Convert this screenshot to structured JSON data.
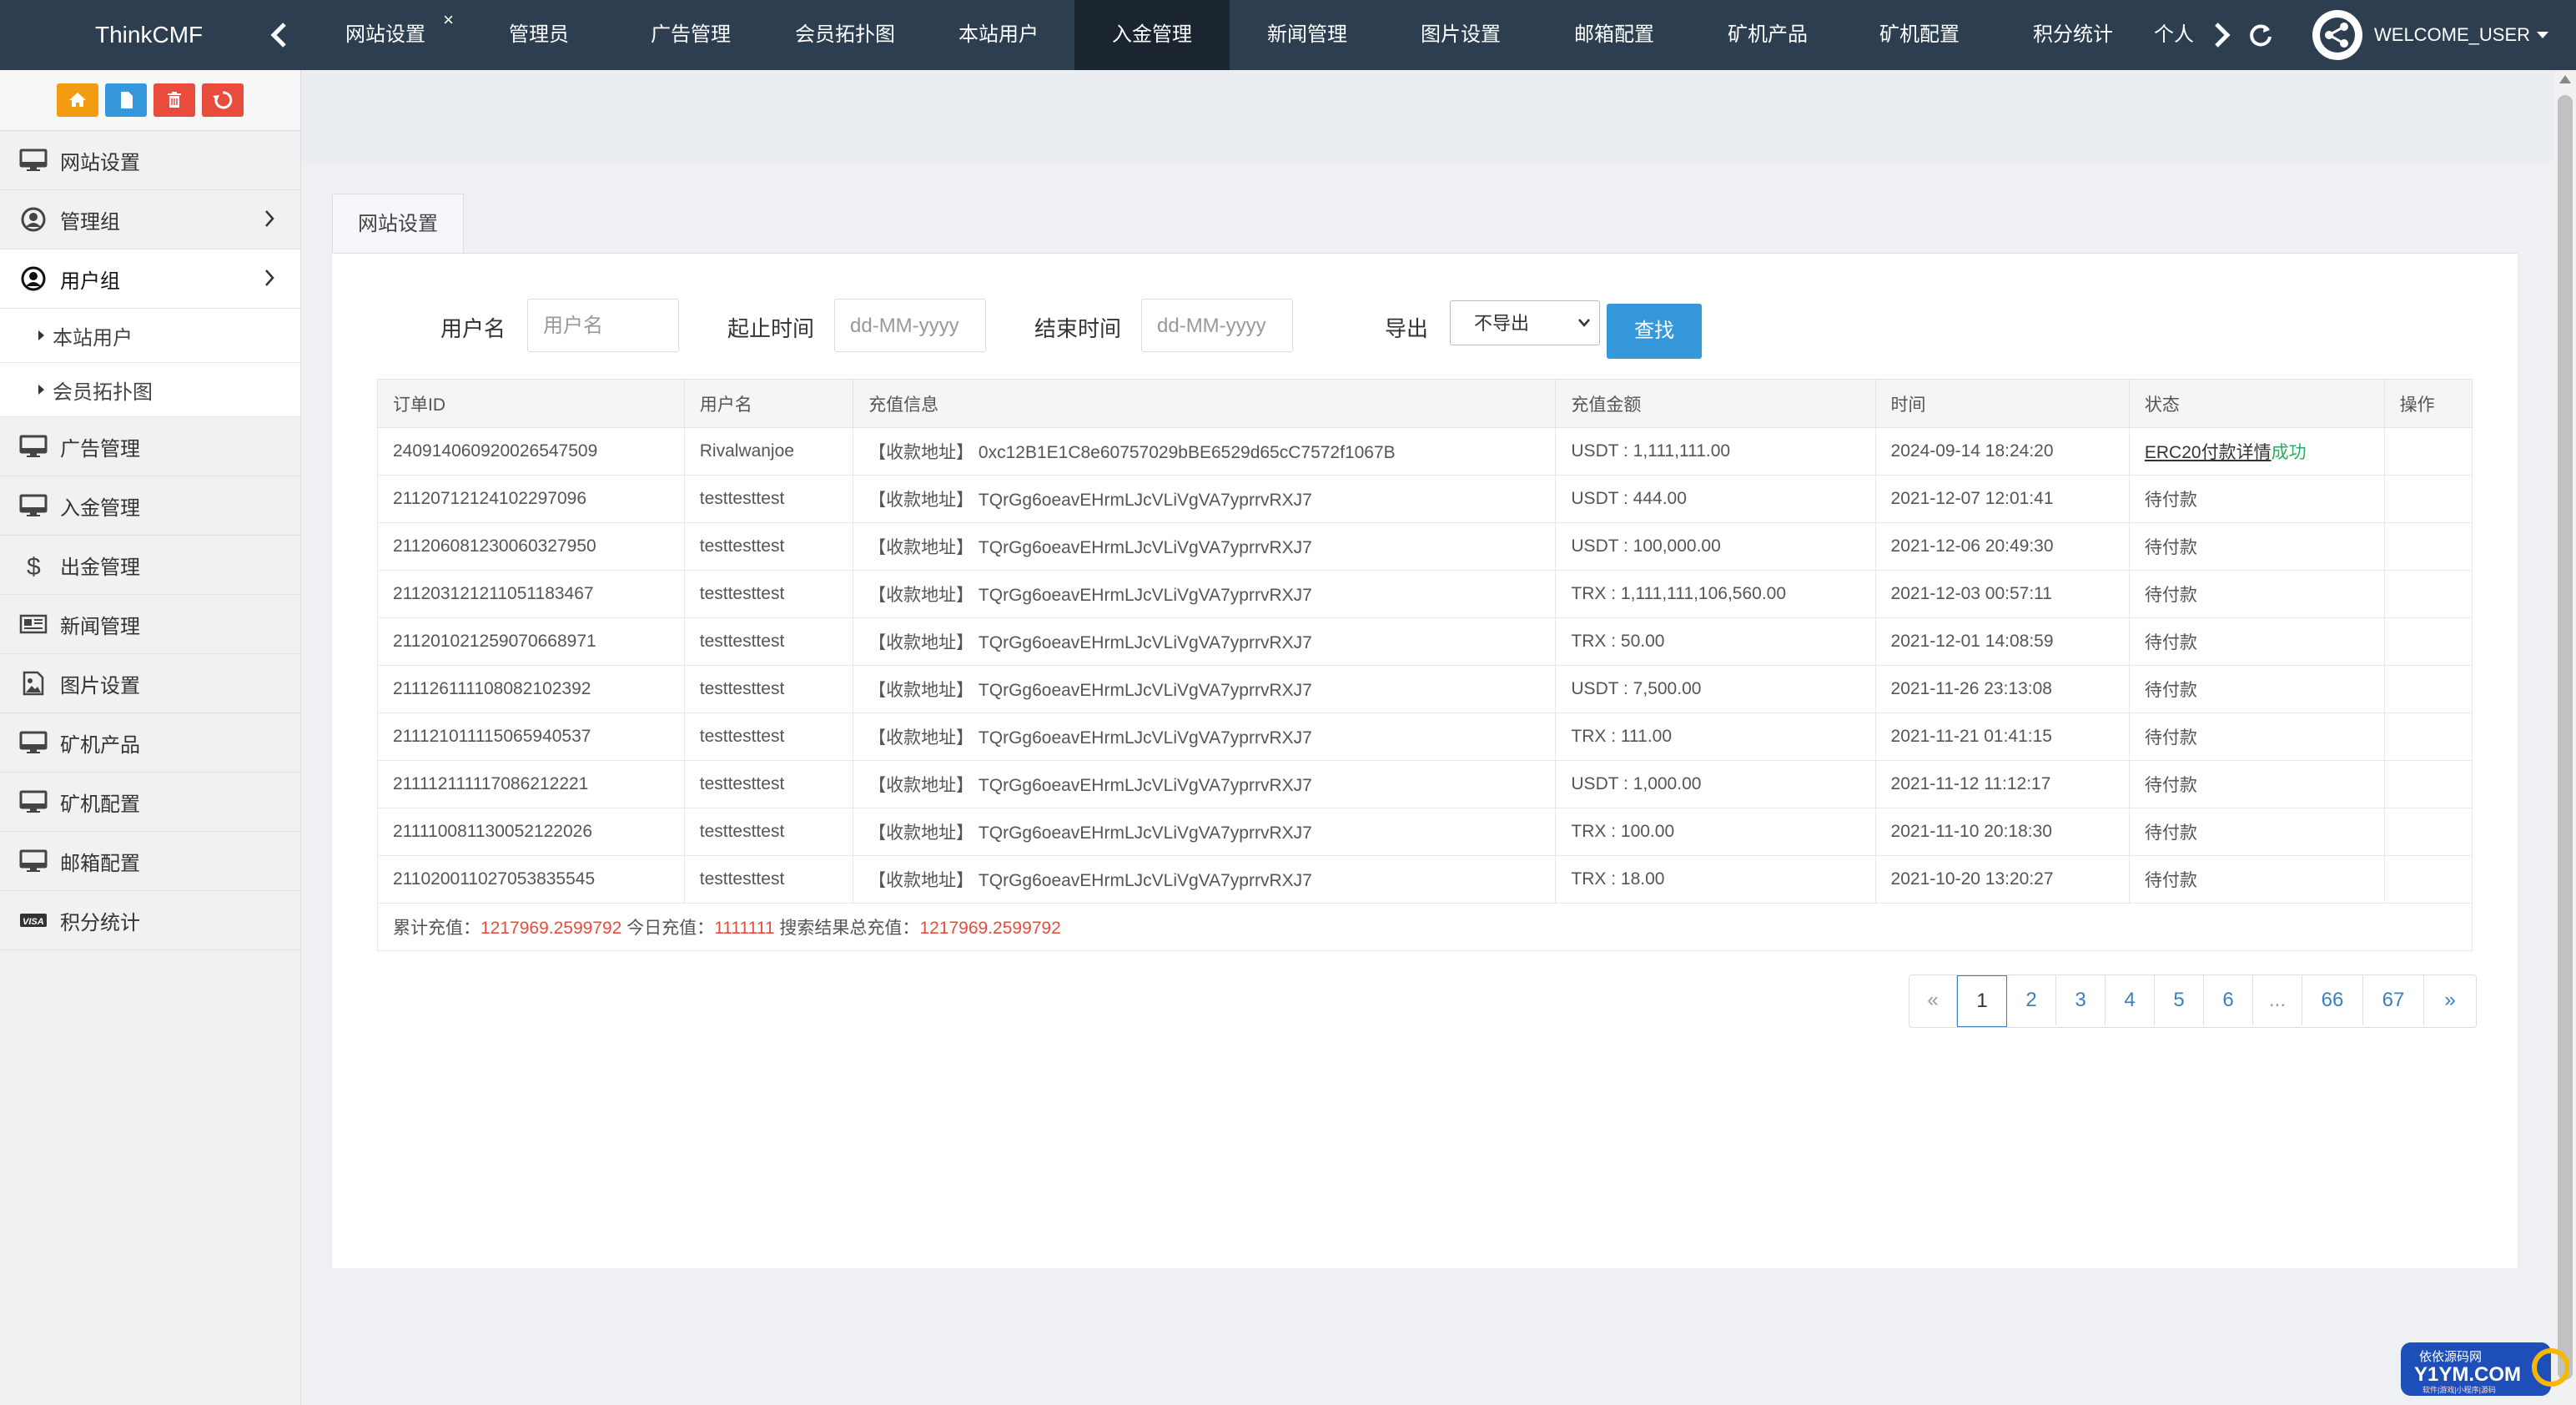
{
  "brand": "ThinkCMF",
  "nav_tabs": [
    {
      "label": "网站设置",
      "closable": true,
      "close_label": "×"
    },
    {
      "label": "管理员"
    },
    {
      "label": "广告管理"
    },
    {
      "label": "会员拓扑图"
    },
    {
      "label": "本站用户"
    },
    {
      "label": "入金管理",
      "active": true
    },
    {
      "label": "新闻管理"
    },
    {
      "label": "图片设置"
    },
    {
      "label": "邮箱配置"
    },
    {
      "label": "矿机产品"
    },
    {
      "label": "矿机配置"
    },
    {
      "label": "积分统计"
    },
    {
      "label": "个人"
    }
  ],
  "user": {
    "welcome": "WELCOME_USER"
  },
  "sidebar": {
    "quick_buttons": [
      {
        "icon": "home-icon",
        "color": "#f39c12"
      },
      {
        "icon": "file-icon",
        "color": "#3498db"
      },
      {
        "icon": "trash-icon",
        "color": "#e74c3c"
      },
      {
        "icon": "recycle-icon",
        "color": "#e74c3c"
      }
    ],
    "items": [
      {
        "label": "网站设置",
        "icon": "monitor-icon"
      },
      {
        "label": "管理组",
        "icon": "user-circle-icon",
        "chevron": true
      },
      {
        "label": "用户组",
        "icon": "user-circle-icon",
        "chevron": true,
        "open": true,
        "sub": [
          {
            "label": "本站用户"
          },
          {
            "label": "会员拓扑图"
          }
        ]
      },
      {
        "label": "广告管理",
        "icon": "monitor-icon"
      },
      {
        "label": "入金管理",
        "icon": "monitor-icon"
      },
      {
        "label": "出金管理",
        "icon": "dollar-icon"
      },
      {
        "label": "新闻管理",
        "icon": "newspaper-icon"
      },
      {
        "label": "图片设置",
        "icon": "image-icon"
      },
      {
        "label": "矿机产品",
        "icon": "monitor-icon"
      },
      {
        "label": "矿机配置",
        "icon": "monitor-icon"
      },
      {
        "label": "邮箱配置",
        "icon": "monitor-icon"
      },
      {
        "label": "积分统计",
        "icon": "visa-icon"
      }
    ]
  },
  "panel_tab": "网站设置",
  "filters": {
    "username_label": "用户名",
    "username_placeholder": "用户名",
    "start_label": "起止时间",
    "start_placeholder": "dd-MM-yyyy",
    "end_label": "结束时间",
    "end_placeholder": "dd-MM-yyyy",
    "export_label": "导出",
    "export_value": "不导出",
    "search_button": "查找"
  },
  "table": {
    "headers": [
      "订单ID",
      "用户名",
      "充值信息",
      "充值金额",
      "时间",
      "状态",
      "操作"
    ],
    "rows": [
      {
        "id": "240914060920026547509",
        "user": "Rivalwanjoe",
        "info": "【收款地址】 0xc12B1E1C8e60757029bBE6529d65cC7572f1067B",
        "amount": "USDT : 1,111,111.00",
        "time": "2024-09-14 18:24:20",
        "status": "ERC20付款详情",
        "status_suffix": "成功"
      },
      {
        "id": "21120712124102297096",
        "user": "testtesttest",
        "info": "【收款地址】 TQrGg6oeavEHrmLJcVLiVgVA7yprrvRXJ7",
        "amount": "USDT : 444.00",
        "time": "2021-12-07 12:01:41",
        "status": "待付款"
      },
      {
        "id": "211206081230060327950",
        "user": "testtesttest",
        "info": "【收款地址】 TQrGg6oeavEHrmLJcVLiVgVA7yprrvRXJ7",
        "amount": "USDT : 100,000.00",
        "time": "2021-12-06 20:49:30",
        "status": "待付款"
      },
      {
        "id": "211203121211051183467",
        "user": "testtesttest",
        "info": "【收款地址】 TQrGg6oeavEHrmLJcVLiVgVA7yprrvRXJ7",
        "amount": "TRX : 1,111,111,106,560.00",
        "time": "2021-12-03 00:57:11",
        "status": "待付款"
      },
      {
        "id": "211201021259070668971",
        "user": "testtesttest",
        "info": "【收款地址】 TQrGg6oeavEHrmLJcVLiVgVA7yprrvRXJ7",
        "amount": "TRX : 50.00",
        "time": "2021-12-01 14:08:59",
        "status": "待付款"
      },
      {
        "id": "211126111108082102392",
        "user": "testtesttest",
        "info": "【收款地址】 TQrGg6oeavEHrmLJcVLiVgVA7yprrvRXJ7",
        "amount": "USDT : 7,500.00",
        "time": "2021-11-26 23:13:08",
        "status": "待付款"
      },
      {
        "id": "211121011115065940537",
        "user": "testtesttest",
        "info": "【收款地址】 TQrGg6oeavEHrmLJcVLiVgVA7yprrvRXJ7",
        "amount": "TRX : 111.00",
        "time": "2021-11-21 01:41:15",
        "status": "待付款"
      },
      {
        "id": "211112111117086212221",
        "user": "testtesttest",
        "info": "【收款地址】 TQrGg6oeavEHrmLJcVLiVgVA7yprrvRXJ7",
        "amount": "USDT : 1,000.00",
        "time": "2021-11-12 11:12:17",
        "status": "待付款"
      },
      {
        "id": "211110081130052122026",
        "user": "testtesttest",
        "info": "【收款地址】 TQrGg6oeavEHrmLJcVLiVgVA7yprrvRXJ7",
        "amount": "TRX : 100.00",
        "time": "2021-11-10 20:18:30",
        "status": "待付款"
      },
      {
        "id": "211020011027053835545",
        "user": "testtesttest",
        "info": "【收款地址】 TQrGg6oeavEHrmLJcVLiVgVA7yprrvRXJ7",
        "amount": "TRX : 18.00",
        "time": "2021-10-20 13:20:27",
        "status": "待付款"
      }
    ],
    "summary": {
      "total_label": "累计充值：",
      "total_value": "1217969.2599792",
      "today_label": " 今日充值：",
      "today_value": "1111111",
      "search_label": " 搜索结果总充值：",
      "search_value": "1217969.2599792"
    }
  },
  "pagination": [
    "«",
    "1",
    "2",
    "3",
    "4",
    "5",
    "6",
    "...",
    "66",
    "67",
    "»"
  ],
  "pagination_current": "1",
  "watermark": {
    "line1": "依依源码网",
    "line2": "Y1YM.COM",
    "line3": "软件|游戏|小程序|源码"
  }
}
